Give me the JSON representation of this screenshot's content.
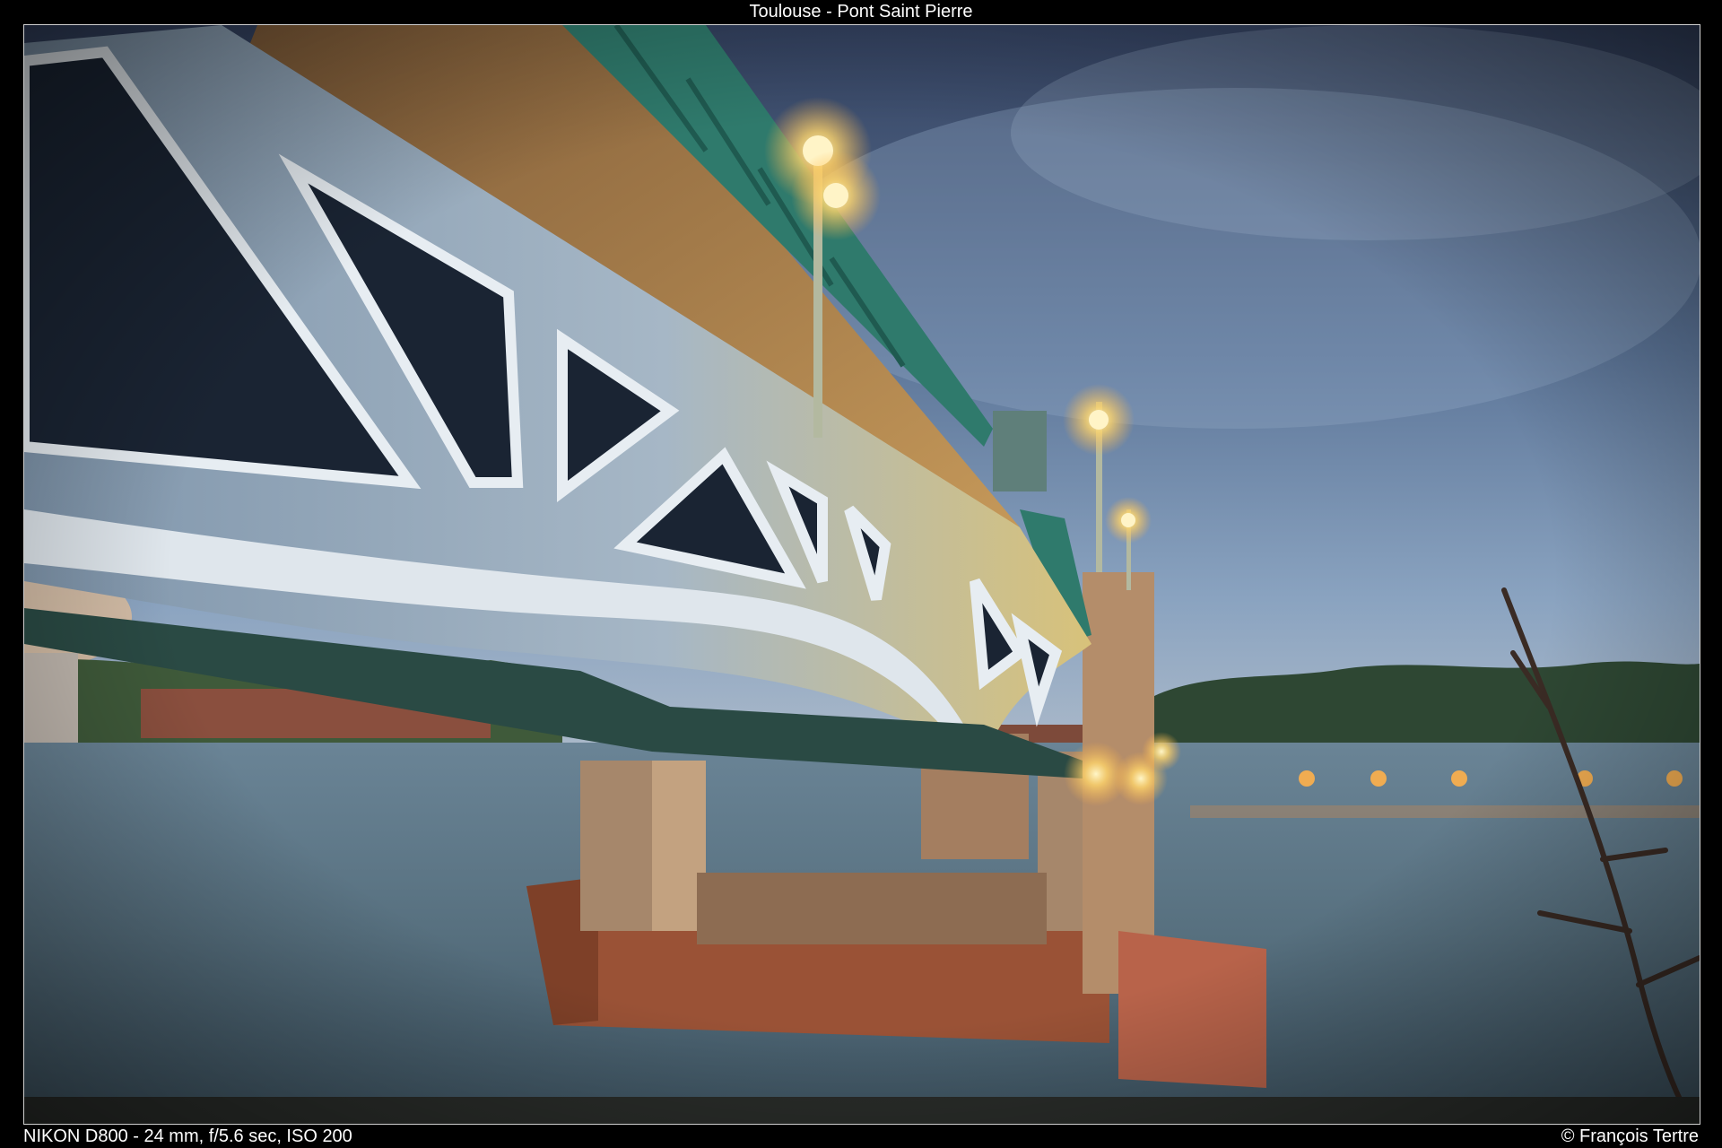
{
  "photo": {
    "title": "Toulouse - Pont Saint Pierre",
    "exif": "NIKON D800 - 24 mm, f/5.6 sec, ISO 200",
    "copyright": "© François Tertre"
  },
  "colors": {
    "frame": "#000000",
    "sky_top": "#3a4a6a",
    "sky_mid": "#6b84a6",
    "river": "#5a7080",
    "bridge_steel": "#8fa6bd",
    "railing": "#2f7a6c",
    "brick": "#a0563a",
    "lamp_glow": "#ffd56b"
  }
}
